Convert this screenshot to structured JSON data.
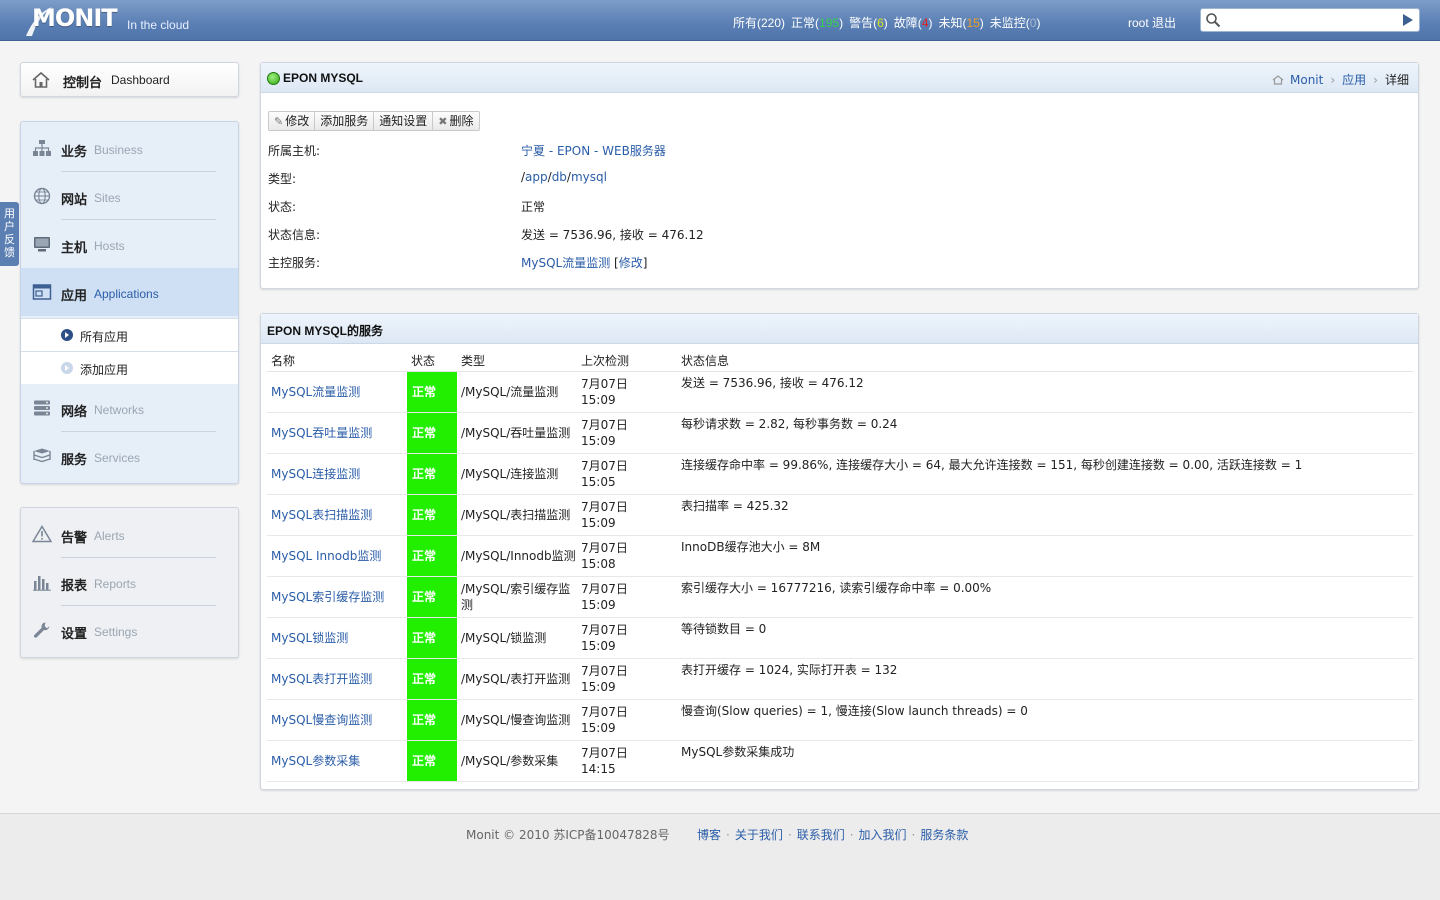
{
  "header": {
    "logo_text": "MONIT",
    "tagline": "In the cloud",
    "counts": [
      {
        "label": "所有(",
        "value": "220",
        "suffix": ")",
        "color": "#ffffff"
      },
      {
        "label": "正常(",
        "value": "195",
        "suffix": ")",
        "color": "#34d34a"
      },
      {
        "label": "警告(",
        "value": "6",
        "suffix": ")",
        "color": "#d8e21b"
      },
      {
        "label": "故障(",
        "value": "4",
        "suffix": ")",
        "color": "#e02020"
      },
      {
        "label": "未知(",
        "value": "15",
        "suffix": ")",
        "color": "#f0a020"
      },
      {
        "label": "未监控(",
        "value": "0",
        "suffix": ")",
        "color": "#a8b6cc"
      }
    ],
    "user": "root",
    "logout": "退出",
    "search_placeholder": ""
  },
  "feedback": "用户反馈",
  "sidebar": {
    "dashboard": {
      "zh": "控制台",
      "en": "Dashboard",
      "icon": "home-icon"
    },
    "main_items": [
      {
        "zh": "业务",
        "en": "Business",
        "icon": "business-icon"
      },
      {
        "zh": "网站",
        "en": "Sites",
        "icon": "globe-icon"
      },
      {
        "zh": "主机",
        "en": "Hosts",
        "icon": "monitor-icon"
      },
      {
        "zh": "应用",
        "en": "Applications",
        "icon": "application-icon",
        "active": true
      },
      {
        "zh": "网络",
        "en": "Networks",
        "icon": "network-icon"
      },
      {
        "zh": "服务",
        "en": "Services",
        "icon": "services-icon"
      }
    ],
    "sub_items": [
      "所有应用",
      "添加应用"
    ],
    "other_items": [
      {
        "zh": "告警",
        "en": "Alerts",
        "icon": "alert-icon"
      },
      {
        "zh": "报表",
        "en": "Reports",
        "icon": "chart-icon"
      },
      {
        "zh": "设置",
        "en": "Settings",
        "icon": "wrench-icon"
      }
    ]
  },
  "detail": {
    "title": "EPON MYSQL",
    "breadcrumb": [
      "Monit",
      "应用",
      "详细"
    ],
    "toolbar": [
      "修改",
      "添加服务",
      "通知设置",
      "删除"
    ],
    "fields": {
      "host_label": "所属主机:",
      "host_value": "宁夏 - EPON - WEB服务器",
      "type_label": "类型:",
      "type_parts": [
        "app",
        "db",
        "mysql"
      ],
      "status_label": "状态:",
      "status_value": "正常",
      "info_label": "状态信息:",
      "info_value": "发送 = 7536.96, 接收 = 476.12",
      "master_label": "主控服务:",
      "master_value": "MySQL流量监测",
      "master_edit": "修改"
    }
  },
  "services": {
    "title": "EPON MYSQL的服务",
    "columns": [
      "名称",
      "状态",
      "类型",
      "上次检测",
      "状态信息"
    ],
    "rows": [
      {
        "name": "MySQL流量监测",
        "status": "正常",
        "type": "/MySQL/流量监测",
        "date": "7月07日",
        "time": "15:09",
        "info": "发送 = 7536.96, 接收 = 476.12"
      },
      {
        "name": "MySQL吞吐量监测",
        "status": "正常",
        "type": "/MySQL/吞吐量监测",
        "date": "7月07日",
        "time": "15:09",
        "info": "每秒请求数 = 2.82, 每秒事务数 = 0.24"
      },
      {
        "name": "MySQL连接监测",
        "status": "正常",
        "type": "/MySQL/连接监测",
        "date": "7月07日",
        "time": "15:05",
        "info": "连接缓存命中率 = 99.86%, 连接缓存大小 = 64, 最大允许连接数 = 151, 每秒创建连接数 = 0.00, 活跃连接数 = 1"
      },
      {
        "name": "MySQL表扫描监测",
        "status": "正常",
        "type": "/MySQL/表扫描监测",
        "date": "7月07日",
        "time": "15:09",
        "info": "表扫描率 = 425.32"
      },
      {
        "name": "MySQL Innodb监测",
        "status": "正常",
        "type": "/MySQL/Innodb监测",
        "date": "7月07日",
        "time": "15:08",
        "info": "InnoDB缓存池大小 = 8M"
      },
      {
        "name": "MySQL索引缓存监测",
        "status": "正常",
        "type": "/MySQL/索引缓存监测",
        "date": "7月07日",
        "time": "15:09",
        "info": "索引缓存大小 = 16777216, 读索引缓存命中率 = 0.00%"
      },
      {
        "name": "MySQL锁监测",
        "status": "正常",
        "type": "/MySQL/锁监测",
        "date": "7月07日",
        "time": "15:09",
        "info": "等待锁数目 = 0"
      },
      {
        "name": "MySQL表打开监测",
        "status": "正常",
        "type": "/MySQL/表打开监测",
        "date": "7月07日",
        "time": "15:09",
        "info": "表打开缓存 = 1024, 实际打开表 = 132"
      },
      {
        "name": "MySQL慢查询监测",
        "status": "正常",
        "type": "/MySQL/慢查询监测",
        "date": "7月07日",
        "time": "15:09",
        "info": "慢查询(Slow queries) = 1, 慢连接(Slow launch threads) = 0"
      },
      {
        "name": "MySQL参数采集",
        "status": "正常",
        "type": "/MySQL/参数采集",
        "date": "7月07日",
        "time": "14:15",
        "info": "MySQL参数采集成功"
      }
    ]
  },
  "footer": {
    "copyright": "Monit © 2010 苏ICP备10047828号",
    "links": [
      "博客",
      "关于我们",
      "联系我们",
      "加入我们",
      "服务条款"
    ]
  }
}
